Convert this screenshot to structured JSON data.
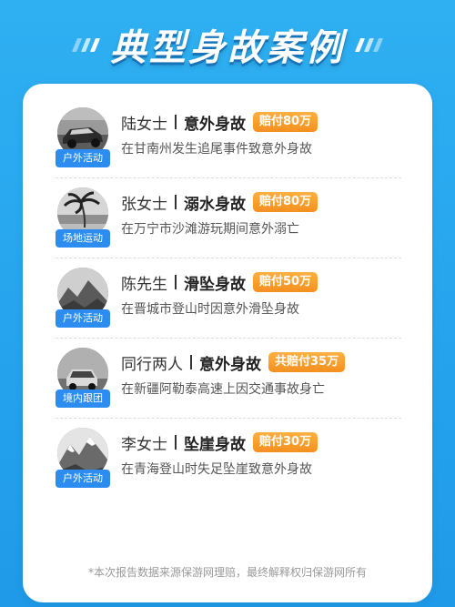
{
  "page": {
    "title": "典型身故案例",
    "footnote": "*本次报告数据来源保游网理赔，最终解释权归保游网所有"
  },
  "cases": [
    {
      "tag": "户外活动",
      "person": "陆女士",
      "cause": "意外身故",
      "payout": "赔付80万",
      "description": "在甘南州发生追尾事件致意外身故",
      "icon": "car-accident-photo"
    },
    {
      "tag": "场地运动",
      "person": "张女士",
      "cause": "溺水身故",
      "payout": "赔付80万",
      "description": "在万宁市沙滩游玩期间意外溺亡",
      "icon": "beach-palm-photo"
    },
    {
      "tag": "户外活动",
      "person": "陈先生",
      "cause": "滑坠身故",
      "payout": "赔付50万",
      "description": "在晋城市登山时因意外滑坠身故",
      "icon": "mountain-photo"
    },
    {
      "tag": "境内跟团",
      "person": "同行两人",
      "cause": "意外身故",
      "payout": "共赔付35万",
      "description": "在新疆阿勒泰高速上因交通事故身亡",
      "icon": "highway-car-photo"
    },
    {
      "tag": "户外活动",
      "person": "李女士",
      "cause": "坠崖身故",
      "payout": "赔付30万",
      "description": "在青海登山时失足坠崖致意外身故",
      "icon": "snow-mountain-photo"
    }
  ],
  "colors": {
    "background": "#27a6ee",
    "tag": "#2d8cf0",
    "payout_badge": "#f5901f"
  }
}
